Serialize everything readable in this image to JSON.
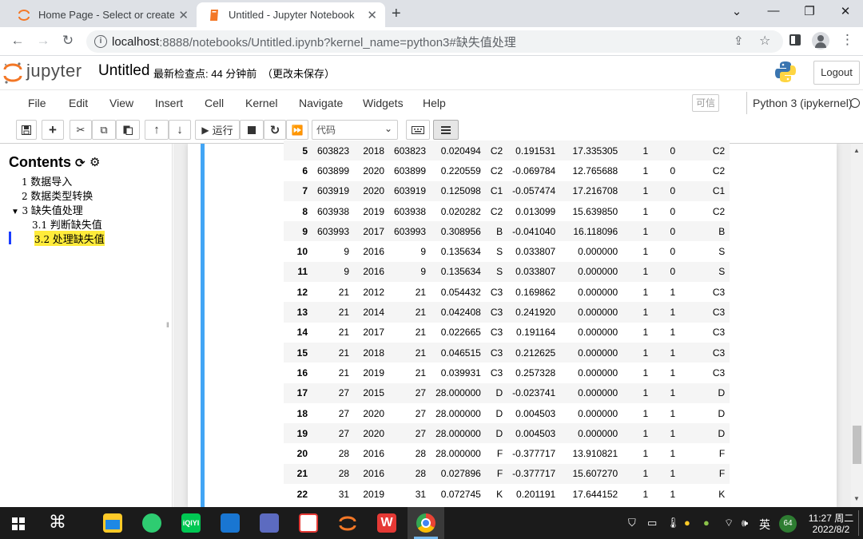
{
  "browser": {
    "tabs": [
      {
        "title": "Home Page - Select or create a",
        "active": false
      },
      {
        "title": "Untitled - Jupyter Notebook",
        "active": true
      }
    ],
    "new_tab": "+",
    "url_host": "localhost",
    "url_rest": ":8888/notebooks/Untitled.ipynb?kernel_name=python3#缺失值处理"
  },
  "jupyter": {
    "logo_text": "jupyter",
    "notebook_name": "Untitled",
    "checkpoint": "最新检查点: 44 分钟前",
    "unsaved": "（更改未保存）",
    "logout": "Logout",
    "menu": [
      "File",
      "Edit",
      "View",
      "Insert",
      "Cell",
      "Kernel",
      "Navigate",
      "Widgets",
      "Help"
    ],
    "trusted": "可信",
    "kernel": "Python 3 (ipykernel)",
    "run_label": "运行",
    "cell_type": "代码"
  },
  "toc": {
    "title": "Contents",
    "items": [
      {
        "num": "1",
        "label": "数据导入"
      },
      {
        "num": "2",
        "label": "数据类型转换"
      },
      {
        "num": "3",
        "label": "缺失值处理"
      },
      {
        "num": "3.1",
        "label": "判断缺失值"
      },
      {
        "num": "3.2",
        "label": "处理缺失值"
      }
    ]
  },
  "table": {
    "rows": [
      [
        "5",
        "603823",
        "2018",
        "603823",
        "0.020494",
        "C2",
        "0.191531",
        "17.335305",
        "1",
        "0",
        "C2"
      ],
      [
        "6",
        "603899",
        "2020",
        "603899",
        "0.220559",
        "C2",
        "-0.069784",
        "12.765688",
        "1",
        "0",
        "C2"
      ],
      [
        "7",
        "603919",
        "2020",
        "603919",
        "0.125098",
        "C1",
        "-0.057474",
        "17.216708",
        "1",
        "0",
        "C1"
      ],
      [
        "8",
        "603938",
        "2019",
        "603938",
        "0.020282",
        "C2",
        "0.013099",
        "15.639850",
        "1",
        "0",
        "C2"
      ],
      [
        "9",
        "603993",
        "2017",
        "603993",
        "0.308956",
        "B",
        "-0.041040",
        "16.118096",
        "1",
        "0",
        "B"
      ],
      [
        "10",
        "9",
        "2016",
        "9",
        "0.135634",
        "S",
        "0.033807",
        "0.000000",
        "1",
        "0",
        "S"
      ],
      [
        "11",
        "9",
        "2016",
        "9",
        "0.135634",
        "S",
        "0.033807",
        "0.000000",
        "1",
        "0",
        "S"
      ],
      [
        "12",
        "21",
        "2012",
        "21",
        "0.054432",
        "C3",
        "0.169862",
        "0.000000",
        "1",
        "1",
        "C3"
      ],
      [
        "13",
        "21",
        "2014",
        "21",
        "0.042408",
        "C3",
        "0.241920",
        "0.000000",
        "1",
        "1",
        "C3"
      ],
      [
        "14",
        "21",
        "2017",
        "21",
        "0.022665",
        "C3",
        "0.191164",
        "0.000000",
        "1",
        "1",
        "C3"
      ],
      [
        "15",
        "21",
        "2018",
        "21",
        "0.046515",
        "C3",
        "0.212625",
        "0.000000",
        "1",
        "1",
        "C3"
      ],
      [
        "16",
        "21",
        "2019",
        "21",
        "0.039931",
        "C3",
        "0.257328",
        "0.000000",
        "1",
        "1",
        "C3"
      ],
      [
        "17",
        "27",
        "2015",
        "27",
        "28.000000",
        "D",
        "-0.023741",
        "0.000000",
        "1",
        "1",
        "D"
      ],
      [
        "18",
        "27",
        "2020",
        "27",
        "28.000000",
        "D",
        "0.004503",
        "0.000000",
        "1",
        "1",
        "D"
      ],
      [
        "19",
        "27",
        "2020",
        "27",
        "28.000000",
        "D",
        "0.004503",
        "0.000000",
        "1",
        "1",
        "D"
      ],
      [
        "20",
        "28",
        "2016",
        "28",
        "28.000000",
        "F",
        "-0.377717",
        "13.910821",
        "1",
        "1",
        "F"
      ],
      [
        "21",
        "28",
        "2016",
        "28",
        "0.027896",
        "F",
        "-0.377717",
        "15.607270",
        "1",
        "1",
        "F"
      ],
      [
        "22",
        "31",
        "2019",
        "31",
        "0.072745",
        "K",
        "0.201191",
        "17.644152",
        "1",
        "1",
        "K"
      ]
    ]
  },
  "taskbar": {
    "ime": "英",
    "badge": "64",
    "time": "11:27 周二",
    "date": "2022/8/2"
  },
  "colors": {
    "cell_selected": "#42a5f5",
    "toc_highlight": "#ffeb3b",
    "jupyter_orange": "#f37726"
  }
}
